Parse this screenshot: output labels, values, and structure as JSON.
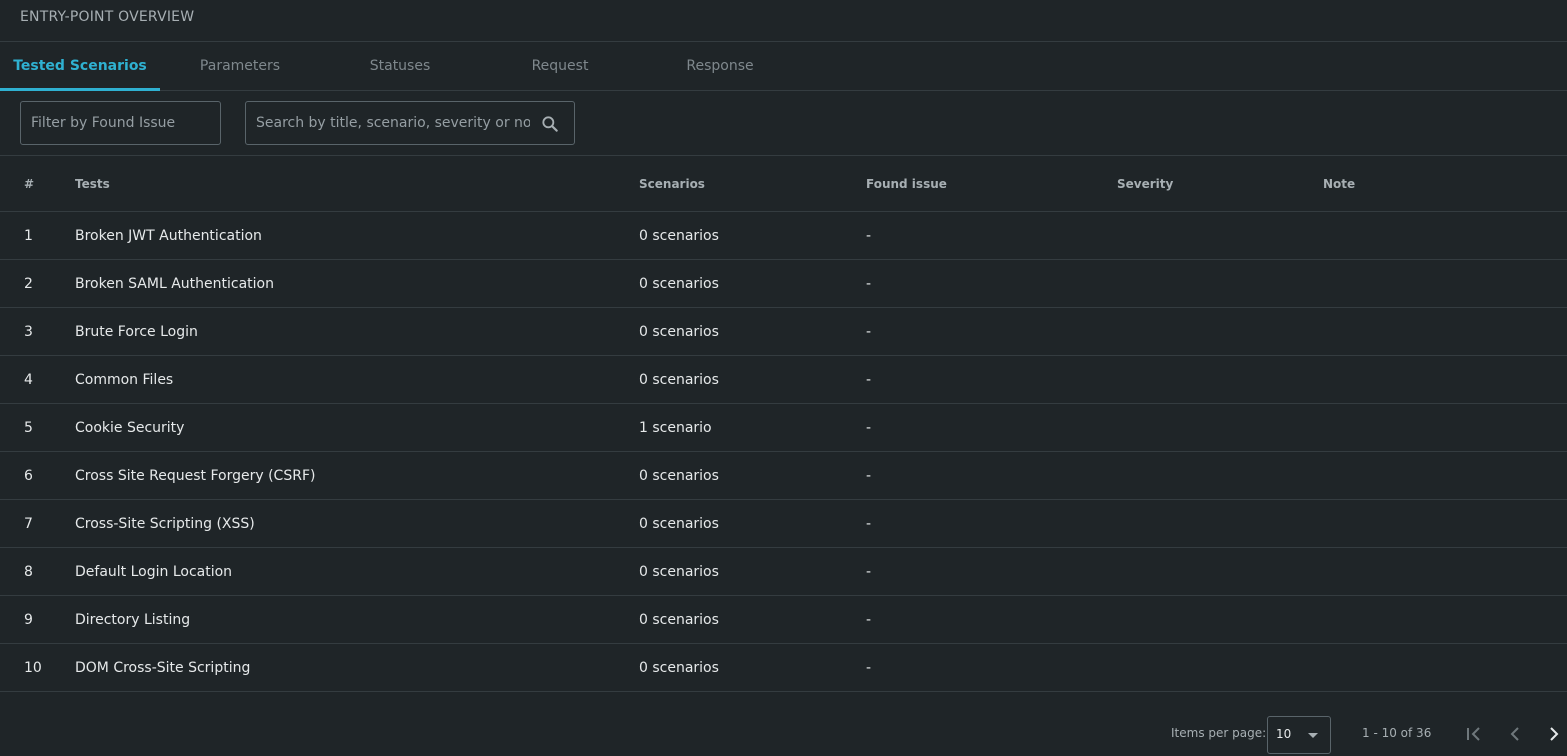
{
  "header": {
    "title": "ENTRY-POINT OVERVIEW"
  },
  "tabs": [
    {
      "label": "Tested Scenarios",
      "active": true
    },
    {
      "label": "Parameters",
      "active": false
    },
    {
      "label": "Statuses",
      "active": false
    },
    {
      "label": "Request",
      "active": false
    },
    {
      "label": "Response",
      "active": false
    }
  ],
  "filters": {
    "found_issue_placeholder": "Filter by Found Issue",
    "search_placeholder": "Search by title, scenario, severity or note",
    "search_icon": "search-icon"
  },
  "table": {
    "columns": [
      "#",
      "Tests",
      "Scenarios",
      "Found issue",
      "Severity",
      "Note"
    ],
    "rows": [
      {
        "num": "1",
        "test": "Broken JWT Authentication",
        "scenarios": "0 scenarios",
        "found_issue": "-",
        "severity": "",
        "note": ""
      },
      {
        "num": "2",
        "test": "Broken SAML Authentication",
        "scenarios": "0 scenarios",
        "found_issue": "-",
        "severity": "",
        "note": ""
      },
      {
        "num": "3",
        "test": "Brute Force Login",
        "scenarios": "0 scenarios",
        "found_issue": "-",
        "severity": "",
        "note": ""
      },
      {
        "num": "4",
        "test": "Common Files",
        "scenarios": "0 scenarios",
        "found_issue": "-",
        "severity": "",
        "note": ""
      },
      {
        "num": "5",
        "test": "Cookie Security",
        "scenarios": "1 scenario",
        "found_issue": "-",
        "severity": "",
        "note": ""
      },
      {
        "num": "6",
        "test": "Cross Site Request Forgery (CSRF)",
        "scenarios": "0 scenarios",
        "found_issue": "-",
        "severity": "",
        "note": ""
      },
      {
        "num": "7",
        "test": "Cross-Site Scripting (XSS)",
        "scenarios": "0 scenarios",
        "found_issue": "-",
        "severity": "",
        "note": ""
      },
      {
        "num": "8",
        "test": "Default Login Location",
        "scenarios": "0 scenarios",
        "found_issue": "-",
        "severity": "",
        "note": ""
      },
      {
        "num": "9",
        "test": "Directory Listing",
        "scenarios": "0 scenarios",
        "found_issue": "-",
        "severity": "",
        "note": ""
      },
      {
        "num": "10",
        "test": "DOM Cross-Site Scripting",
        "scenarios": "0 scenarios",
        "found_issue": "-",
        "severity": "",
        "note": ""
      }
    ]
  },
  "paginator": {
    "items_per_page_label": "Items per page:",
    "page_size": "10",
    "range_label": "1 - 10 of 36",
    "icons": [
      "first-page-icon",
      "previous-page-icon",
      "next-page-icon"
    ]
  },
  "colors": {
    "background": "#1f2528",
    "accent": "#2fb1d1",
    "divider": "#343c40"
  }
}
